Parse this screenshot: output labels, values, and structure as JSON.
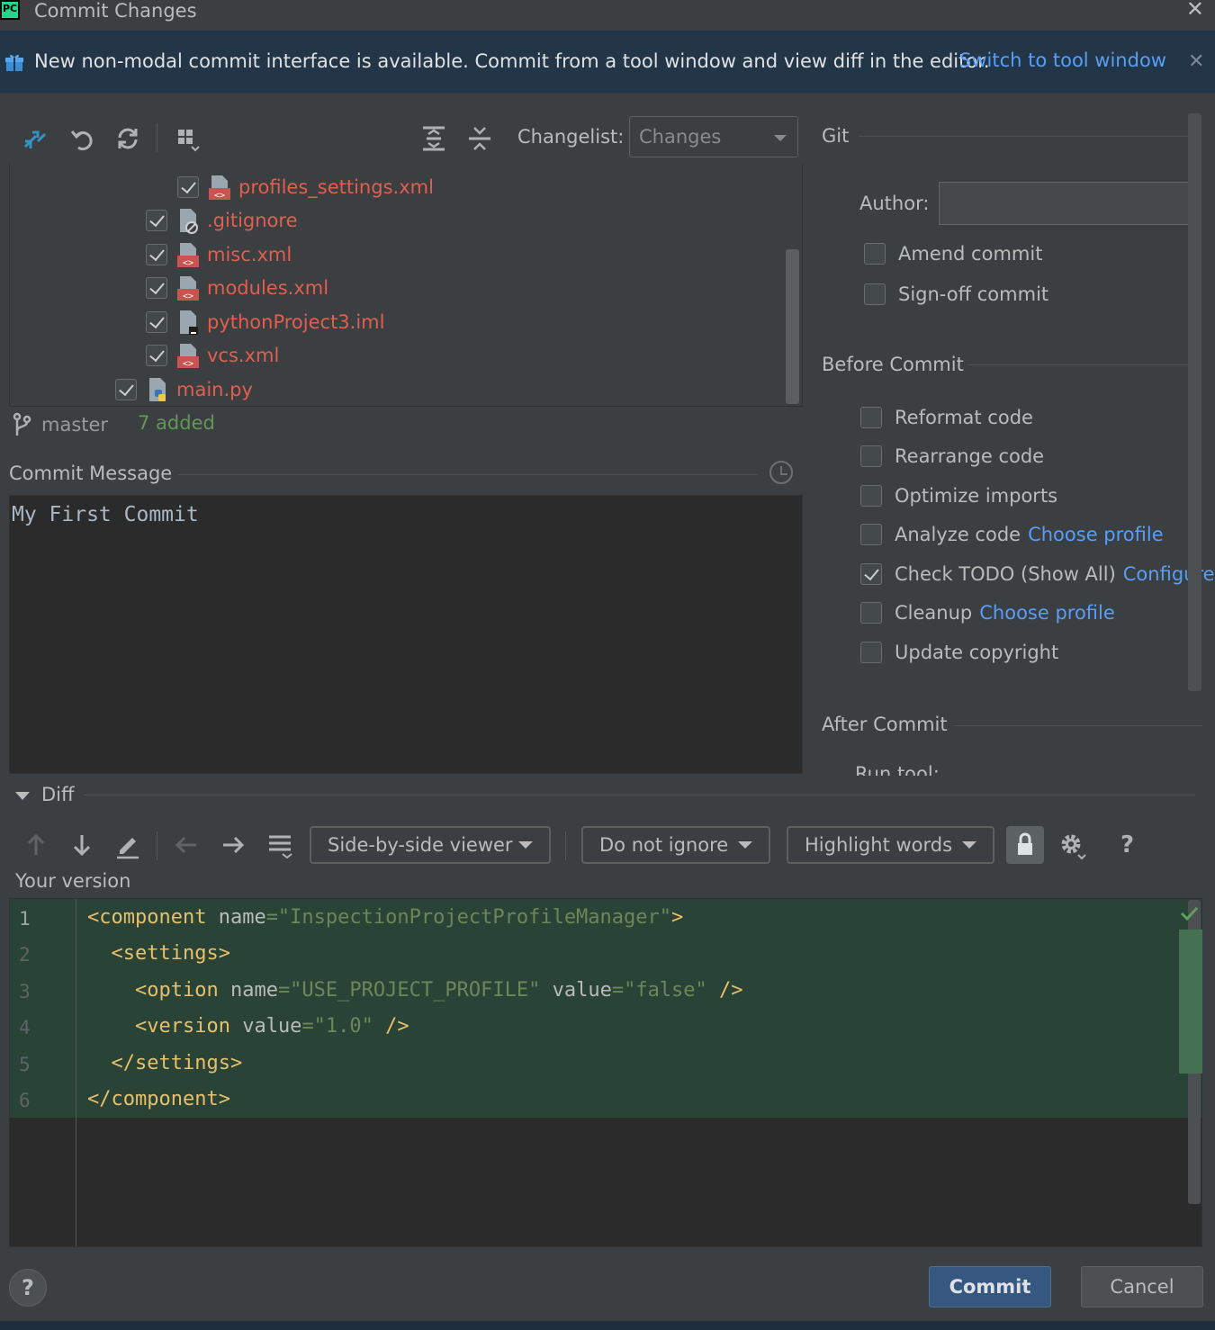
{
  "window": {
    "title": "Commit Changes",
    "app_logo": "PC"
  },
  "banner": {
    "text": "New non-modal commit interface is available. Commit from a tool window and view diff in the editor.",
    "link": "Switch to tool window"
  },
  "changes_toolbar": {
    "changelist_label": "Changelist:",
    "changelist_value": "Changes"
  },
  "file_tree": {
    "items": [
      {
        "name": "profiles_settings.xml",
        "checked": true
      },
      {
        "name": ".gitignore",
        "checked": true
      },
      {
        "name": "misc.xml",
        "checked": true
      },
      {
        "name": "modules.xml",
        "checked": true
      },
      {
        "name": "pythonProject3.iml",
        "checked": true
      },
      {
        "name": "vcs.xml",
        "checked": true
      },
      {
        "name": "main.py",
        "checked": true
      }
    ]
  },
  "status": {
    "branch": "master",
    "added": "7 added"
  },
  "commit_message": {
    "title": "Commit Message",
    "value": "My First Commit"
  },
  "git": {
    "title": "Git",
    "author_label": "Author:",
    "author_value": "",
    "amend_label": "Amend commit",
    "signoff_label": "Sign-off commit"
  },
  "before_commit": {
    "title": "Before Commit",
    "options": [
      {
        "label": "Reformat code",
        "checked": false,
        "link": ""
      },
      {
        "label": "Rearrange code",
        "checked": false,
        "link": ""
      },
      {
        "label": "Optimize imports",
        "checked": false,
        "link": ""
      },
      {
        "label": "Analyze code",
        "checked": false,
        "link": "Choose profile"
      },
      {
        "label": "Check TODO (Show All)",
        "checked": true,
        "link": "Configure"
      },
      {
        "label": "Cleanup",
        "checked": false,
        "link": "Choose profile"
      },
      {
        "label": "Update copyright",
        "checked": false,
        "link": ""
      }
    ]
  },
  "after_commit": {
    "title": "After Commit",
    "run_tool": "Run tool:"
  },
  "diff": {
    "title": "Diff",
    "viewer": "Side-by-side viewer",
    "ignore": "Do not ignore",
    "highlight": "Highlight words",
    "help": "?",
    "your_version": "Your version",
    "lines": [
      "1",
      "2",
      "3",
      "4",
      "5",
      "6"
    ]
  },
  "footer": {
    "help": "?",
    "commit": "Commit",
    "cancel": "Cancel"
  }
}
